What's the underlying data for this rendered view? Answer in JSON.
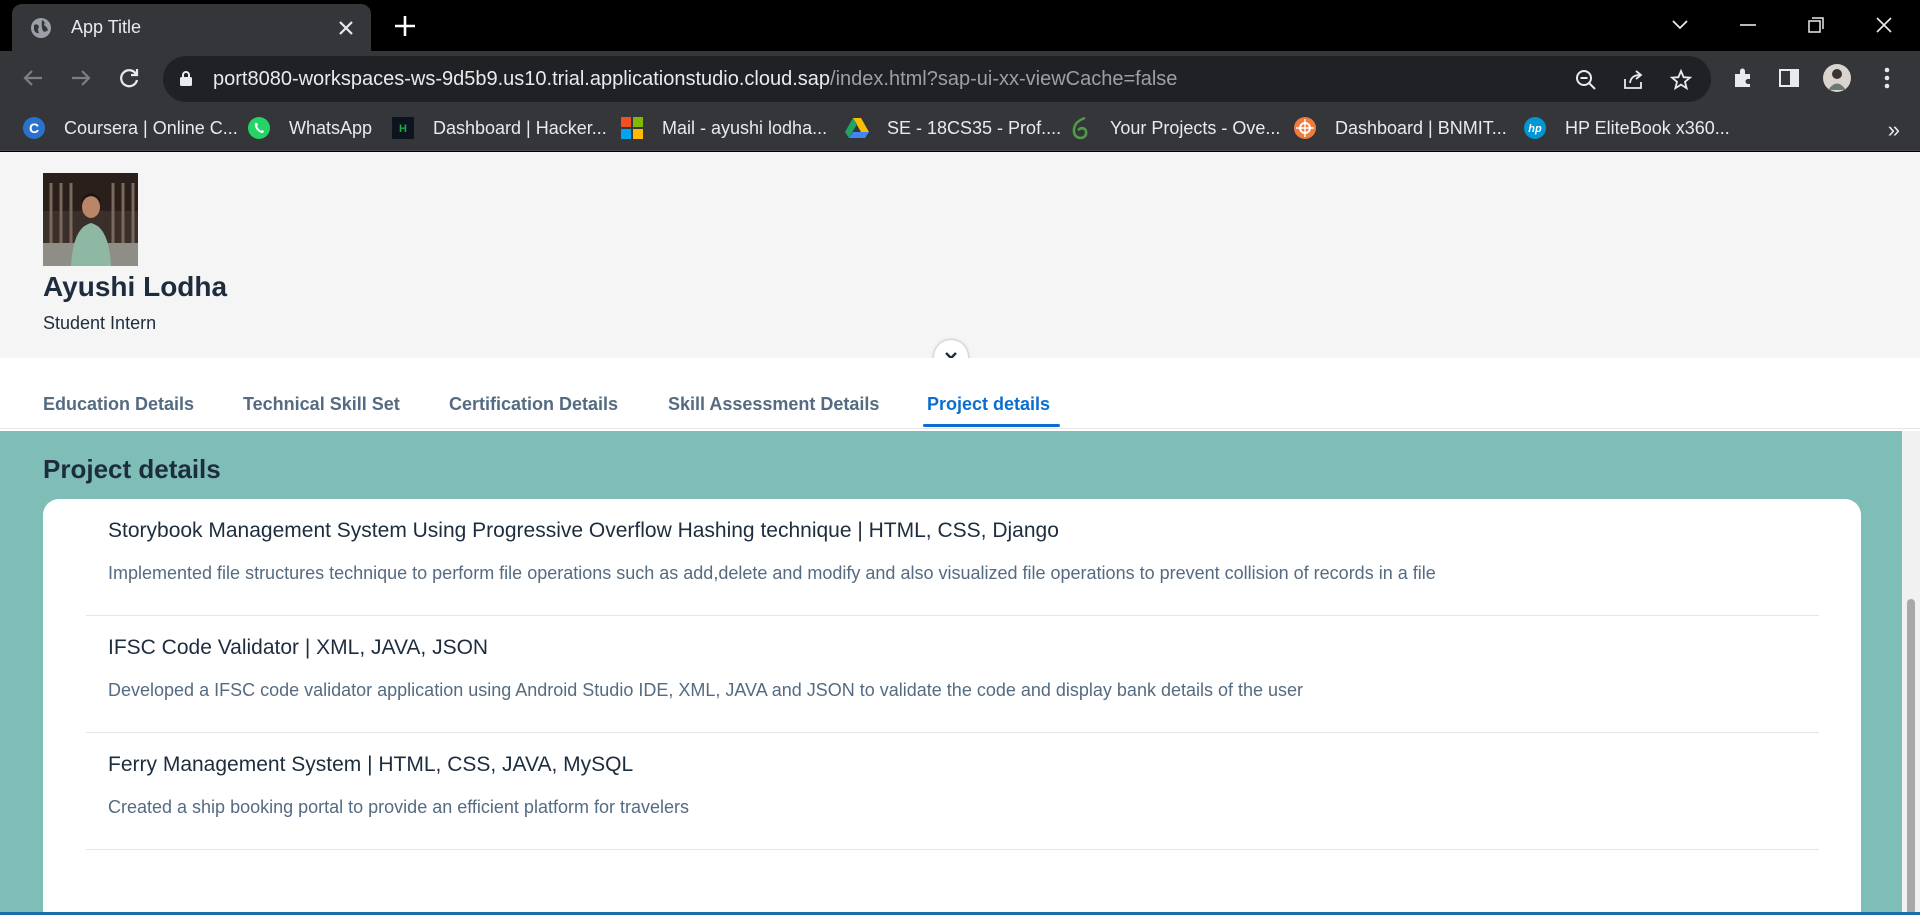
{
  "browser": {
    "tab_title": "App Title",
    "url_host": "port8080-workspaces-ws-9d5b9.us10.trial.applicationstudio.cloud.sap",
    "url_path": "/index.html?sap-ui-xx-viewCache=false",
    "more_bookmarks": "»",
    "bookmarks": [
      {
        "label": "Coursera | Online C...",
        "icon": "coursera-icon",
        "color": "#2a73cc"
      },
      {
        "label": "WhatsApp",
        "icon": "whatsapp-icon",
        "color": "#25d366"
      },
      {
        "label": "Dashboard | Hacker...",
        "icon": "hackerrank-icon",
        "color": "#1ba94c"
      },
      {
        "label": "Mail - ayushi lodha...",
        "icon": "microsoft-icon",
        "color": "#f25022"
      },
      {
        "label": "SE - 18CS35 - Prof....",
        "icon": "google-drive-icon",
        "color": "#fbbc04"
      },
      {
        "label": "Your Projects - Ove...",
        "icon": "overleaf-icon",
        "color": "#4f9c45"
      },
      {
        "label": "Dashboard | BNMIT...",
        "icon": "bnmit-icon",
        "color": "#f07b3f"
      },
      {
        "label": "HP EliteBook x360...",
        "icon": "hp-icon",
        "color": "#0096d6"
      }
    ]
  },
  "profile": {
    "name": "Ayushi Lodha",
    "role": "Student Intern"
  },
  "tabs": [
    {
      "label": "Education Details",
      "active": false
    },
    {
      "label": "Technical Skill Set",
      "active": false
    },
    {
      "label": "Certification Details",
      "active": false
    },
    {
      "label": "Skill Assessment Details",
      "active": false
    },
    {
      "label": "Project details",
      "active": true
    }
  ],
  "section": {
    "title": "Project details",
    "background": "#7fbeb6",
    "projects": [
      {
        "title": "Storybook Management System Using Progressive Overflow Hashing technique | HTML, CSS, Django",
        "description": "Implemented file structures technique to perform file operations such as add,delete and modify and also visualized file operations to prevent collision of records in a file"
      },
      {
        "title": "IFSC Code Validator | XML, JAVA, JSON",
        "description": "Developed a IFSC code validator application using Android Studio IDE, XML, JAVA and JSON to validate the code and display bank details of the user"
      },
      {
        "title": "Ferry Management System | HTML, CSS, JAVA, MySQL",
        "description": "Created a ship booking portal to provide an efficient platform for travelers"
      }
    ]
  },
  "colors": {
    "accent": "#0a6ed1",
    "text_primary": "#1d2d3e",
    "text_secondary": "#556b82"
  }
}
